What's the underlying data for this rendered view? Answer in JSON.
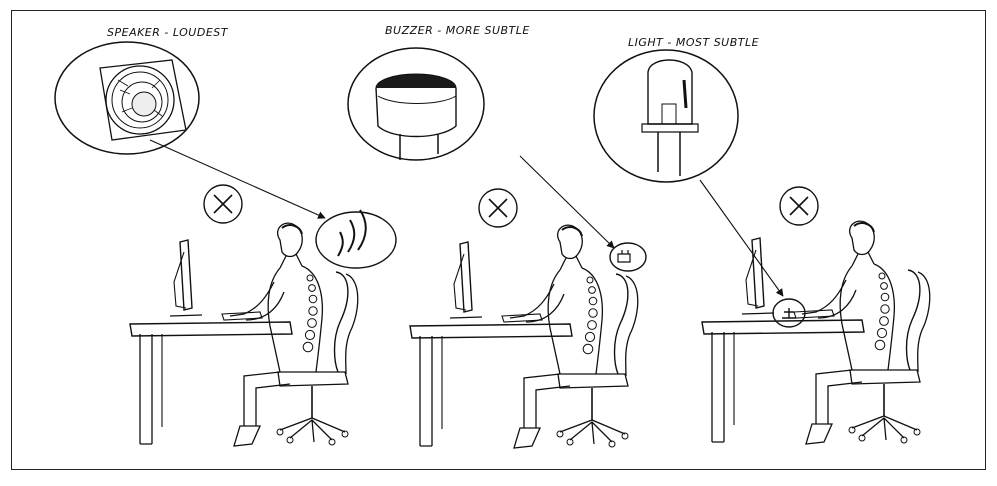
{
  "labels": {
    "speaker": "SPEAKER - LOUDEST",
    "buzzer": "BUZZER - MORE SUBTLE",
    "light": "LIGHT - MOST SUBTLE"
  },
  "icons": [
    "speaker-icon",
    "buzzer-icon",
    "led-light-icon",
    "cross-icon",
    "person-at-desk-icon"
  ],
  "colors": {
    "ink": "#111111",
    "paper": "#ffffff",
    "buzzer_body": "#1a1a1a"
  }
}
